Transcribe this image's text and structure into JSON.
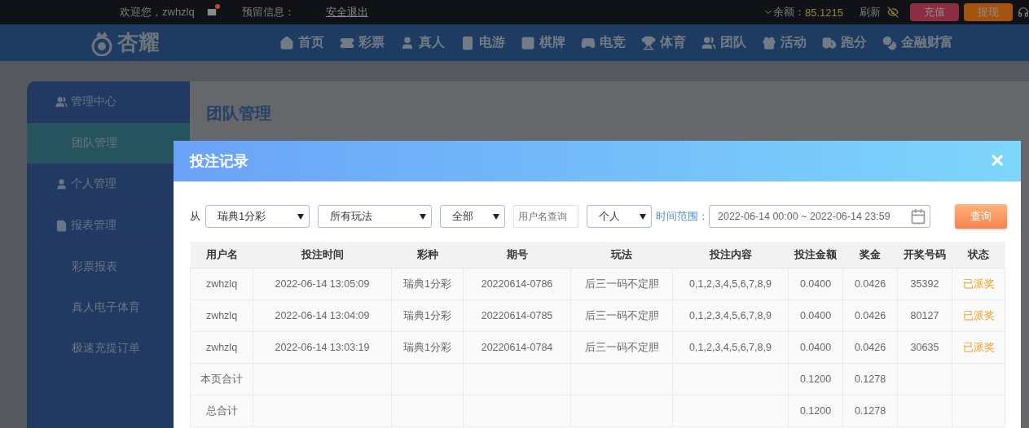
{
  "top_bar": {
    "welcome": "欢迎您，zwhzlq",
    "reserved_label": "预留信息：",
    "logout": "安全退出",
    "balance_label": "余额：",
    "balance": "85.1215",
    "refresh": "刷新",
    "deposit": "充值",
    "withdraw": "提现"
  },
  "nav": {
    "logo": "杏耀",
    "items": [
      {
        "label": "首页"
      },
      {
        "label": "彩票"
      },
      {
        "label": "真人"
      },
      {
        "label": "电游"
      },
      {
        "label": "棋牌"
      },
      {
        "label": "电竞"
      },
      {
        "label": "体育"
      },
      {
        "label": "团队"
      },
      {
        "label": "活动"
      },
      {
        "label": "跑分"
      },
      {
        "label": "金融财富"
      }
    ]
  },
  "sidebar": {
    "items": [
      {
        "label": "管理中心",
        "kind": "section",
        "selected": false
      },
      {
        "label": "团队管理",
        "kind": "link",
        "selected": true
      },
      {
        "label": "个人管理",
        "kind": "section",
        "selected": false
      },
      {
        "label": "报表管理",
        "kind": "section",
        "selected": false
      },
      {
        "label": "彩票报表",
        "kind": "link",
        "selected": false
      },
      {
        "label": "真人电子体育",
        "kind": "link",
        "selected": false
      },
      {
        "label": "极速充提订单",
        "kind": "link",
        "selected": false
      }
    ]
  },
  "page_title": "团队管理",
  "modal": {
    "title": "投注记录",
    "close": "✕",
    "filters": {
      "from_label": "从",
      "lottery": "瑞典1分彩",
      "play": "所有玩法",
      "status": "全部",
      "username_placeholder": "用户名查询",
      "scope": "个人",
      "time_label": "时间范围：",
      "time_range": "2022-06-14 00:00 ~ 2022-06-14 23:59",
      "query": "查询"
    },
    "table": {
      "columns": [
        "用户名",
        "投注时间",
        "彩种",
        "期号",
        "玩法",
        "投注内容",
        "投注金额",
        "奖金",
        "开奖号码",
        "状态"
      ],
      "rows": [
        [
          "zwhzlq",
          "2022-06-14 13:05:09",
          "瑞典1分彩",
          "20220614-0786",
          "后三一码不定胆",
          "0,1,2,3,4,5,6,7,8,9",
          "0.0400",
          "0.0426",
          "35392",
          "已派奖"
        ],
        [
          "zwhzlq",
          "2022-06-14 13:04:09",
          "瑞典1分彩",
          "20220614-0785",
          "后三一码不定胆",
          "0,1,2,3,4,5,6,7,8,9",
          "0.0400",
          "0.0426",
          "80127",
          "已派奖"
        ],
        [
          "zwhzlq",
          "2022-06-14 13:03:19",
          "瑞典1分彩",
          "20220614-0784",
          "后三一码不定胆",
          "0,1,2,3,4,5,6,7,8,9",
          "0.0400",
          "0.0426",
          "30635",
          "已派奖"
        ]
      ],
      "totals": [
        {
          "label": "本页合计",
          "amount": "0.1200",
          "prize": "0.1278"
        },
        {
          "label": "总合计",
          "amount": "0.1200",
          "prize": "0.1278"
        }
      ]
    }
  }
}
